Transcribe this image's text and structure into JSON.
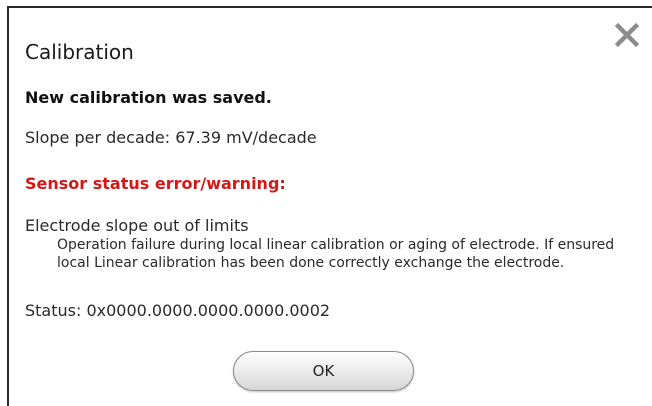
{
  "dialog": {
    "title": "Calibration",
    "close_icon": "close-icon",
    "saved_message": "New calibration was saved.",
    "slope_text": "Slope per decade: 67.39 mV/decade",
    "sensor_status_heading": "Sensor status error/warning:",
    "error_title": "Electrode slope out of limits",
    "error_description": "Operation failure during local linear calibration or aging of electrode. If ensured local Linear calibration has been done correctly exchange the electrode.",
    "status_code": "Status: 0x0000.0000.0000.0000.0002",
    "ok_label": "OK"
  },
  "colors": {
    "error_heading": "#d41818",
    "border": "#2a2a2a",
    "close_icon": "#8c8c8c"
  }
}
